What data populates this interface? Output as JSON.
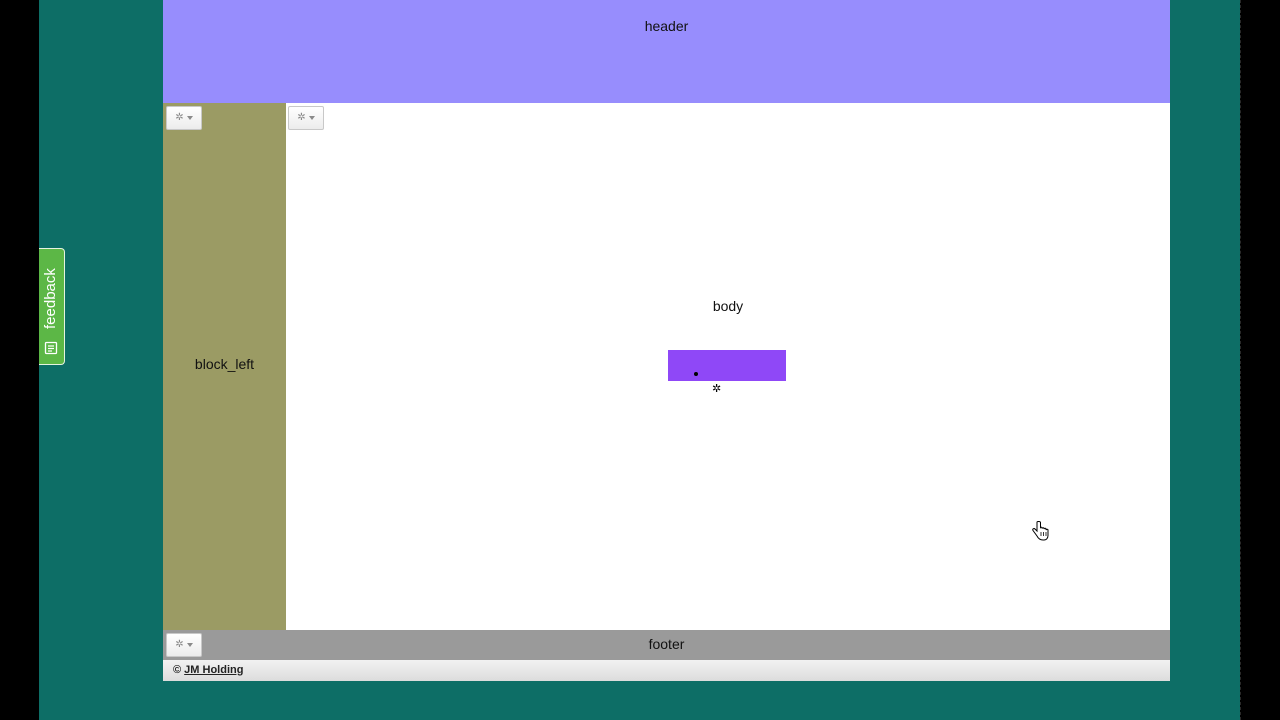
{
  "layout": {
    "header_label": "header",
    "block_left_label": "block_left",
    "body_label": "body",
    "footer_label": "footer"
  },
  "copyright": {
    "symbol": "©",
    "company": "JM Holding"
  },
  "feedback": {
    "label": "feedback",
    "icon": "feedback-note-icon"
  },
  "icons": {
    "settings": "gear-icon",
    "dropdown": "caret-down-icon",
    "cursor": "hand-pointer-icon"
  },
  "colors": {
    "header": "#978dfd",
    "block_left": "#9b9b64",
    "body": "#ffffff",
    "footer": "#9a9a9a",
    "widget": "#8f48f7",
    "feedback": "#5cb746",
    "background": "#0d6e66"
  }
}
